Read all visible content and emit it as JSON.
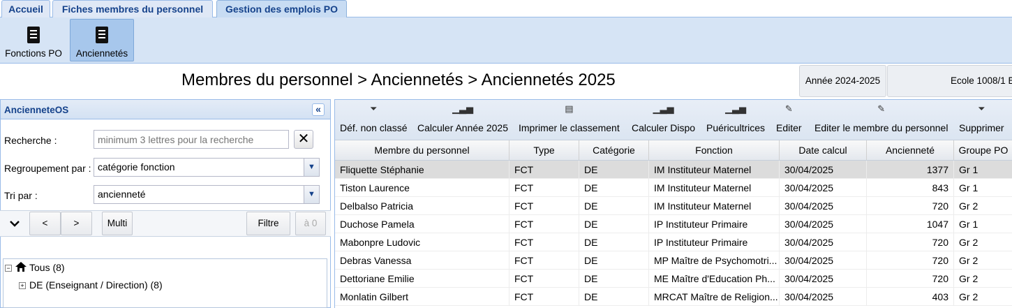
{
  "tabs": [
    "Accueil",
    "Fiches membres du personnel",
    "Gestion des emplois PO"
  ],
  "ribbon": {
    "fonctions": "Fonctions PO",
    "anciennetes": "Anciennetés"
  },
  "breadcrumb": "Membres du personnel > Anciennetés > Anciennetés 2025",
  "annee": "Année 2024-2025",
  "ecole": "Ecole 1008/1 E",
  "left": {
    "title": "AncienneteOS",
    "recherche_label": "Recherche :",
    "recherche_placeholder": "minimum 3 lettres pour la recherche",
    "regroupement_label": "Regroupement par :",
    "regroupement_value": "catégorie fonction",
    "tri_label": "Tri par :",
    "tri_value": "ancienneté",
    "nav": {
      "prev": "<",
      "next": ">",
      "multi": "Multi",
      "filtre": "Filtre",
      "count": "à 0"
    },
    "tree": {
      "root": "Tous (8)",
      "child": "DE (Enseignant / Direction) (8)"
    }
  },
  "toolbar": [
    "Déf. non classé",
    "Calculer Année 2025",
    "Imprimer le classement",
    "Calculer Dispo",
    "Puéricultrices",
    "Editer",
    "Editer le membre du personnel",
    "Supprimer"
  ],
  "columns": [
    "Membre du personnel",
    "Type",
    "Catégorie",
    "Fonction",
    "Date calcul",
    "Ancienneté",
    "Groupe PO"
  ],
  "rows": [
    [
      "Fliquette Stéphanie",
      "FCT",
      "DE",
      "IM Instituteur Maternel",
      "30/04/2025",
      "1377",
      "Gr 1"
    ],
    [
      "Tiston Laurence",
      "FCT",
      "DE",
      "IM Instituteur Maternel",
      "30/04/2025",
      "843",
      "Gr 1"
    ],
    [
      "Delbalso Patricia",
      "FCT",
      "DE",
      "IM Instituteur Maternel",
      "30/04/2025",
      "720",
      "Gr 2"
    ],
    [
      "Duchose Pamela",
      "FCT",
      "DE",
      "IP Instituteur Primaire",
      "30/04/2025",
      "1047",
      "Gr 1"
    ],
    [
      "Mabonpre Ludovic",
      "FCT",
      "DE",
      "IP Instituteur Primaire",
      "30/04/2025",
      "720",
      "Gr 2"
    ],
    [
      "Debras Vanessa",
      "FCT",
      "DE",
      "MP Maître de Psychomotri...",
      "30/04/2025",
      "720",
      "Gr 2"
    ],
    [
      "Dettoriane Emilie",
      "FCT",
      "DE",
      "ME Maître d'Education Ph...",
      "30/04/2025",
      "720",
      "Gr 2"
    ],
    [
      "Monlatin Gilbert",
      "FCT",
      "DE",
      "MRCAT Maître de Religion...",
      "30/04/2025",
      "403",
      "Gr 2"
    ]
  ]
}
